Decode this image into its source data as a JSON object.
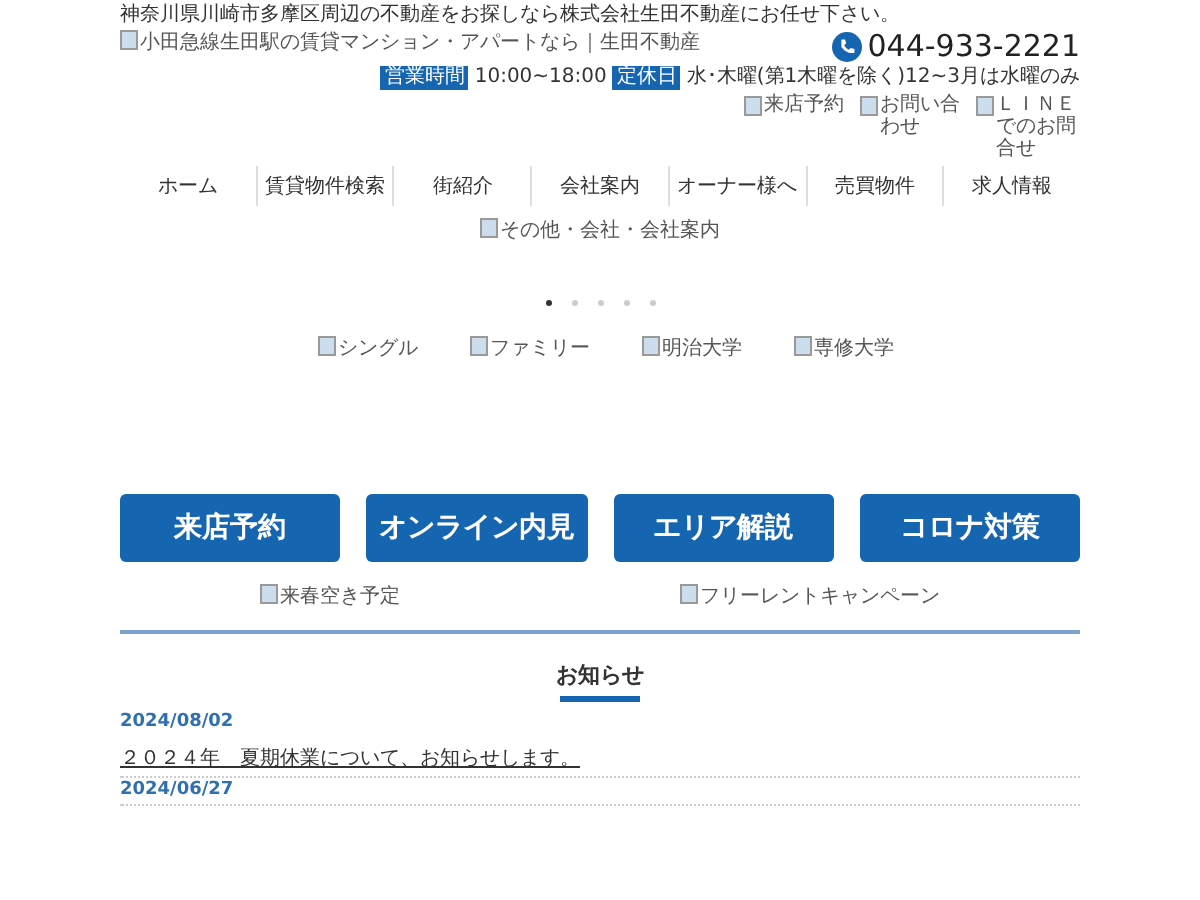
{
  "tagline": "神奈川県川崎市多摩区周辺の不動産をお探しなら株式会社生田不動産にお任せ下さい。",
  "logo_alt": "小田急線生田駅の賃貸マンション・アパートなら｜生田不動産",
  "phone": "044-933-2221",
  "hours": {
    "label": "営業時間",
    "value": "10:00~18:00"
  },
  "holiday": {
    "label": "定休日",
    "value": "水･木曜(第1木曜を除く)12~3月は水曜のみ"
  },
  "header_links": [
    "来店予約",
    "お問い合わせ",
    "ＬＩＮＥでのお問合せ"
  ],
  "nav": [
    "ホーム",
    "賃貸物件検索",
    "街紹介",
    "会社案内",
    "オーナー様へ",
    "売買物件",
    "求人情報"
  ],
  "hero_alt": "その他・会社・会社案内",
  "slider_dots": [
    {
      "selected": true
    },
    {
      "selected": false
    },
    {
      "selected": false
    },
    {
      "selected": false
    },
    {
      "selected": false
    }
  ],
  "categories": [
    "シングル",
    "ファミリー",
    "明治大学",
    "専修大学"
  ],
  "buttons": [
    "来店予約",
    "オンライン内見",
    "エリア解説",
    "コロナ対策"
  ],
  "banners": [
    "来春空き予定",
    "フリーレントキャンペーン"
  ],
  "news": {
    "title": "お知らせ",
    "items": [
      {
        "date": "2024/08/02",
        "text": "２０２４年　夏期休業について、お知らせします。"
      },
      {
        "date": "2024/06/27"
      }
    ]
  }
}
